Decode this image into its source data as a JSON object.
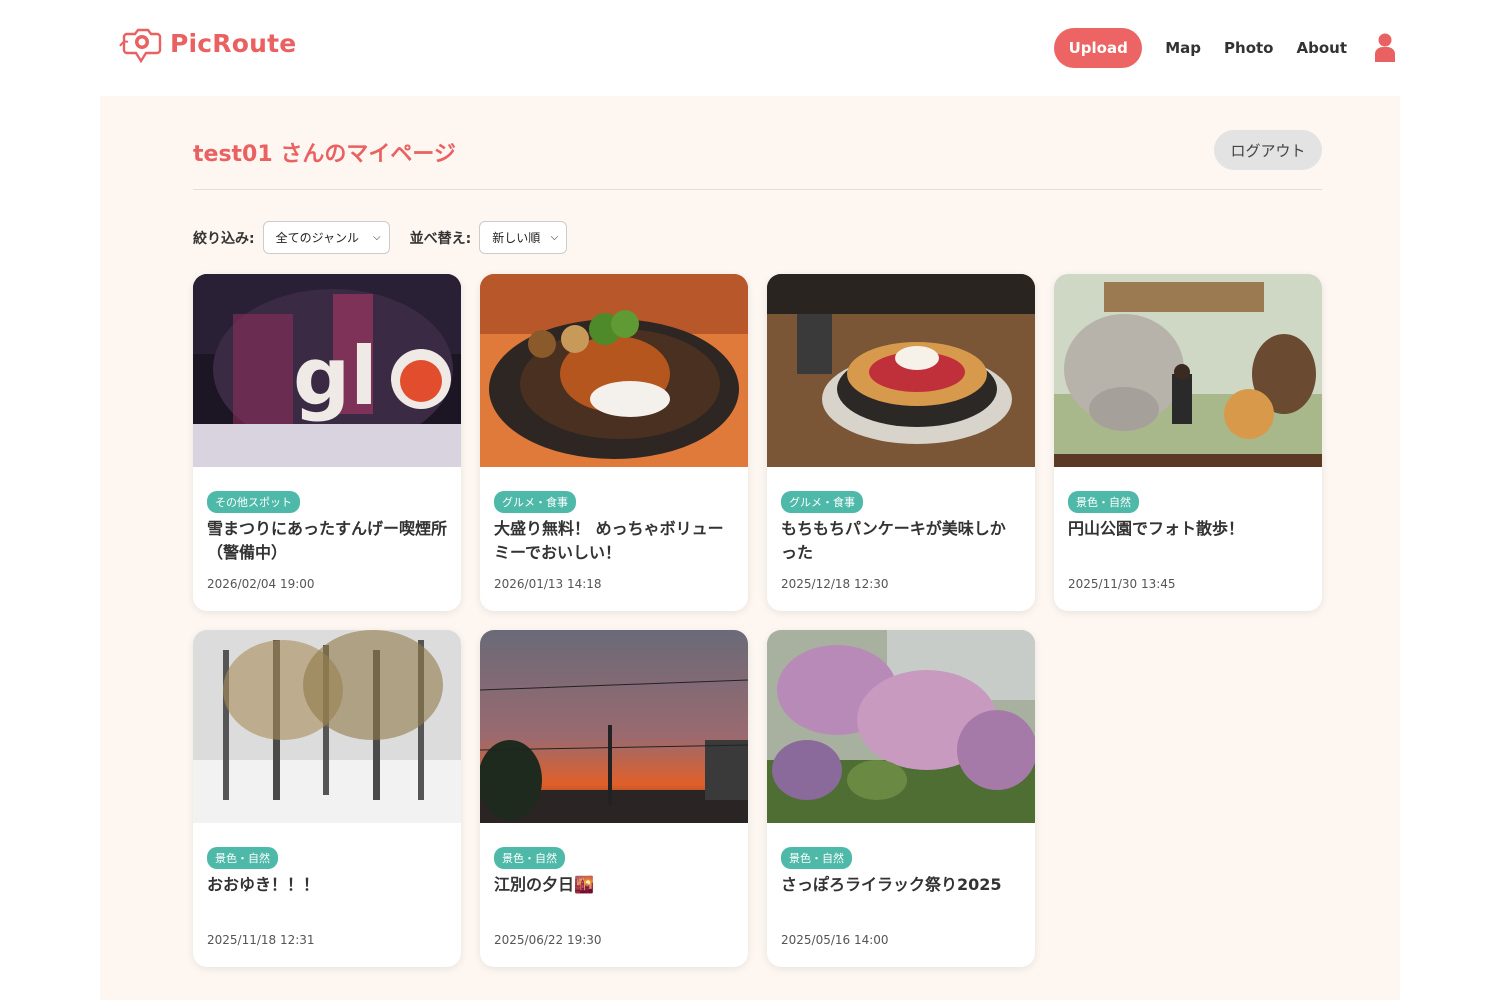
{
  "header": {
    "logo_text": "PicRoute",
    "nav": {
      "upload": "Upload",
      "map": "Map",
      "photo": "Photo",
      "about": "About"
    }
  },
  "page": {
    "title": "test01 さんのマイページ",
    "logout": "ログアウト"
  },
  "filters": {
    "filter_label": "絞り込み:",
    "genre_selected": "全てのジャンル",
    "sort_label": "並べ替え:",
    "sort_selected": "新しい順"
  },
  "posts": [
    {
      "tag": "その他スポット",
      "title": "雪まつりにあったすんげー喫煙所（警備中）",
      "date": "2026/02/04 19:00"
    },
    {
      "tag": "グルメ・食事",
      "title": "大盛り無料！ めっちゃボリューミーでおいしい！",
      "date": "2026/01/13 14:18"
    },
    {
      "tag": "グルメ・食事",
      "title": "もちもちパンケーキが美味しかった",
      "date": "2025/12/18 12:30"
    },
    {
      "tag": "景色・自然",
      "title": "円山公園でフォト散歩！",
      "date": "2025/11/30 13:45"
    },
    {
      "tag": "景色・自然",
      "title": "おおゆき！！！",
      "date": "2025/11/18 12:31"
    },
    {
      "tag": "景色・自然",
      "title": "江別の夕日🌇",
      "date": "2025/06/22 19:30"
    },
    {
      "tag": "景色・自然",
      "title": "さっぽろライラック祭り2025",
      "date": "2025/05/16 14:00"
    }
  ],
  "colors": {
    "accent": "#ec6464",
    "tag": "#4fb9a9",
    "panel": "#fdf6f1"
  }
}
